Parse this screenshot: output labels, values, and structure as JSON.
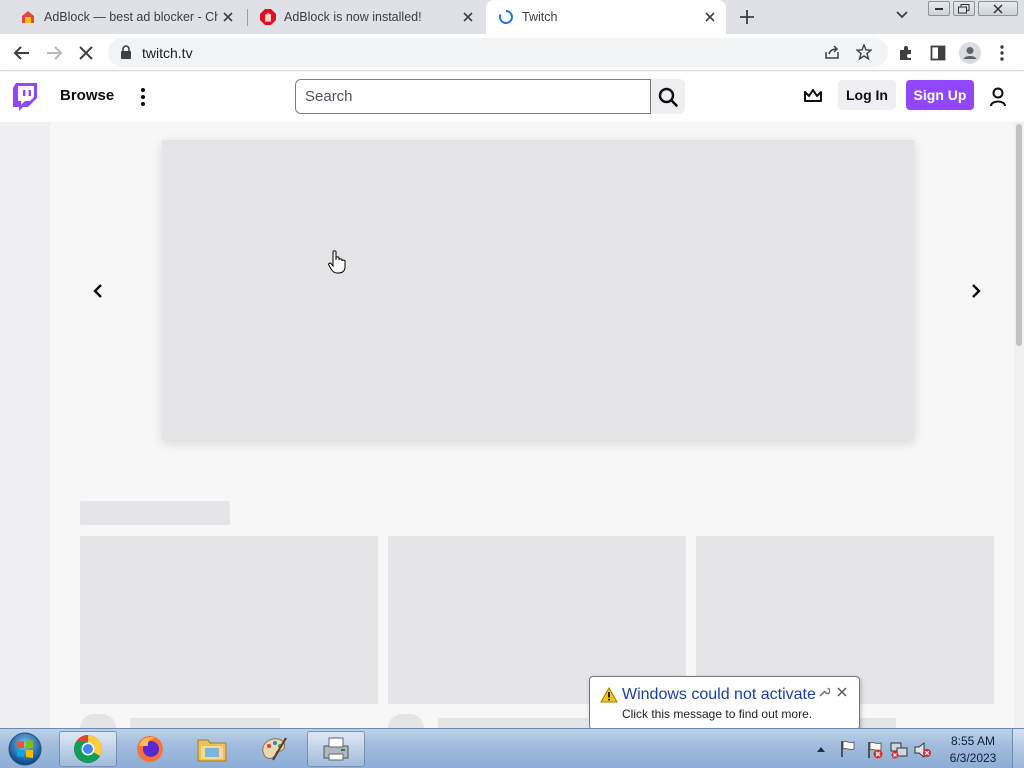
{
  "browser": {
    "tabs": [
      {
        "title": "AdBlock — best ad blocker - Chr",
        "favicon": "adblock-chrome-store-icon",
        "active": false
      },
      {
        "title": "AdBlock is now installed!",
        "favicon": "adblock-hand-icon",
        "active": false
      },
      {
        "title": "Twitch",
        "favicon": "loading-spinner-icon",
        "active": true
      }
    ],
    "url": "twitch.tv",
    "toolbar_icons": [
      "back-arrow-icon",
      "forward-arrow-icon",
      "stop-loading-icon",
      "lock-icon",
      "share-icon",
      "bookmark-star-icon",
      "extensions-puzzle-icon",
      "side-panel-icon",
      "profile-icon",
      "menu-dots-icon"
    ]
  },
  "twitch": {
    "nav": {
      "browse_label": "Browse",
      "search_placeholder": "Search",
      "login_label": "Log In",
      "signup_label": "Sign Up"
    },
    "colors": {
      "brand": "#9147ff",
      "skeleton": "#e5e5e9",
      "background": "#f7f7f8"
    },
    "loading": true
  },
  "notification": {
    "title": "Windows could not activate",
    "message": "Click this message to find out more."
  },
  "taskbar": {
    "apps": [
      "chrome-icon",
      "firefox-icon",
      "file-explorer-icon",
      "paint-icon",
      "printer-fax-icon"
    ],
    "tray_icons": [
      "show-hidden-icons-arrow",
      "action-center-flag-icon",
      "network-icon",
      "volume-muted-icon"
    ],
    "time": "8:55 AM",
    "date": "6/3/2023"
  }
}
